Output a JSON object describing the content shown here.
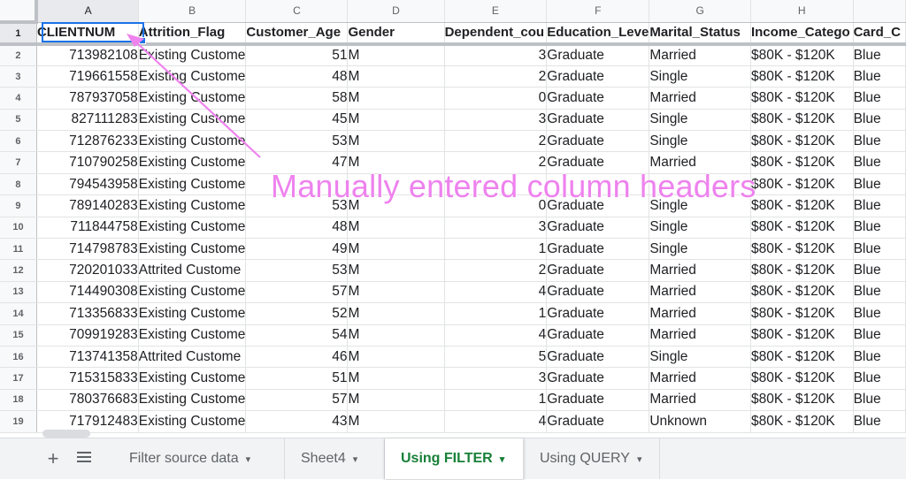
{
  "columns": [
    "A",
    "B",
    "C",
    "D",
    "E",
    "F",
    "G",
    "H",
    ""
  ],
  "column_widths": [],
  "headers": [
    "CLIENTNUM",
    "Attrition_Flag",
    "Customer_Age",
    "Gender",
    "Dependent_cou",
    "Education_Leve",
    "Marital_Status",
    "Income_Catego",
    "Card_C"
  ],
  "rows": [
    {
      "n": "2",
      "c": [
        "713982108",
        "Existing Custome",
        "51",
        "M",
        "3",
        "Graduate",
        "Married",
        "$80K - $120K",
        "Blue"
      ]
    },
    {
      "n": "3",
      "c": [
        "719661558",
        "Existing Custome",
        "48",
        "M",
        "2",
        "Graduate",
        "Single",
        "$80K - $120K",
        "Blue"
      ]
    },
    {
      "n": "4",
      "c": [
        "787937058",
        "Existing Custome",
        "58",
        "M",
        "0",
        "Graduate",
        "Married",
        "$80K - $120K",
        "Blue"
      ]
    },
    {
      "n": "5",
      "c": [
        "827111283",
        "Existing Custome",
        "45",
        "M",
        "3",
        "Graduate",
        "Single",
        "$80K - $120K",
        "Blue"
      ]
    },
    {
      "n": "6",
      "c": [
        "712876233",
        "Existing Custome",
        "53",
        "M",
        "2",
        "Graduate",
        "Single",
        "$80K - $120K",
        "Blue"
      ]
    },
    {
      "n": "7",
      "c": [
        "710790258",
        "Existing Custome",
        "47",
        "M",
        "2",
        "Graduate",
        "Married",
        "$80K - $120K",
        "Blue"
      ]
    },
    {
      "n": "8",
      "c": [
        "794543958",
        "Existing Custome",
        "",
        "",
        "",
        "",
        "",
        "$80K - $120K",
        "Blue"
      ]
    },
    {
      "n": "9",
      "c": [
        "789140283",
        "Existing Custome",
        "53",
        "M",
        "0",
        "Graduate",
        "Single",
        "$80K - $120K",
        "Blue"
      ]
    },
    {
      "n": "10",
      "c": [
        "711844758",
        "Existing Custome",
        "48",
        "M",
        "3",
        "Graduate",
        "Single",
        "$80K - $120K",
        "Blue"
      ]
    },
    {
      "n": "11",
      "c": [
        "714798783",
        "Existing Custome",
        "49",
        "M",
        "1",
        "Graduate",
        "Single",
        "$80K - $120K",
        "Blue"
      ]
    },
    {
      "n": "12",
      "c": [
        "720201033",
        "Attrited Custome",
        "53",
        "M",
        "2",
        "Graduate",
        "Married",
        "$80K - $120K",
        "Blue"
      ]
    },
    {
      "n": "13",
      "c": [
        "714490308",
        "Existing Custome",
        "57",
        "M",
        "4",
        "Graduate",
        "Married",
        "$80K - $120K",
        "Blue"
      ]
    },
    {
      "n": "14",
      "c": [
        "713356833",
        "Existing Custome",
        "52",
        "M",
        "1",
        "Graduate",
        "Married",
        "$80K - $120K",
        "Blue"
      ]
    },
    {
      "n": "15",
      "c": [
        "709919283",
        "Existing Custome",
        "54",
        "M",
        "4",
        "Graduate",
        "Married",
        "$80K - $120K",
        "Blue"
      ]
    },
    {
      "n": "16",
      "c": [
        "713741358",
        "Attrited Custome",
        "46",
        "M",
        "5",
        "Graduate",
        "Single",
        "$80K - $120K",
        "Blue"
      ]
    },
    {
      "n": "17",
      "c": [
        "715315833",
        "Existing Custome",
        "51",
        "M",
        "3",
        "Graduate",
        "Married",
        "$80K - $120K",
        "Blue"
      ]
    },
    {
      "n": "18",
      "c": [
        "780376683",
        "Existing Custome",
        "57",
        "M",
        "1",
        "Graduate",
        "Married",
        "$80K - $120K",
        "Blue"
      ]
    },
    {
      "n": "19",
      "c": [
        "717912483",
        "Existing Custome",
        "43",
        "M",
        "4",
        "Graduate",
        "Unknown",
        "$80K - $120K",
        "Blue"
      ]
    }
  ],
  "header_row_number": "1",
  "annotation": {
    "text": "Manually entered column headers",
    "color": "#ee82ee"
  },
  "tabs": [
    {
      "label": "Filter source data",
      "active": false
    },
    {
      "label": "Sheet4",
      "active": false
    },
    {
      "label": "Using FILTER",
      "active": true
    },
    {
      "label": "Using QUERY",
      "active": false
    }
  ],
  "tabbar": {
    "add_icon": "+",
    "menu_icon": "all-sheets-icon",
    "caret": "▾"
  },
  "colors": {
    "active_tab": "#188038",
    "selection": "#1a73e8",
    "header_bg": "#f8f9fa"
  }
}
